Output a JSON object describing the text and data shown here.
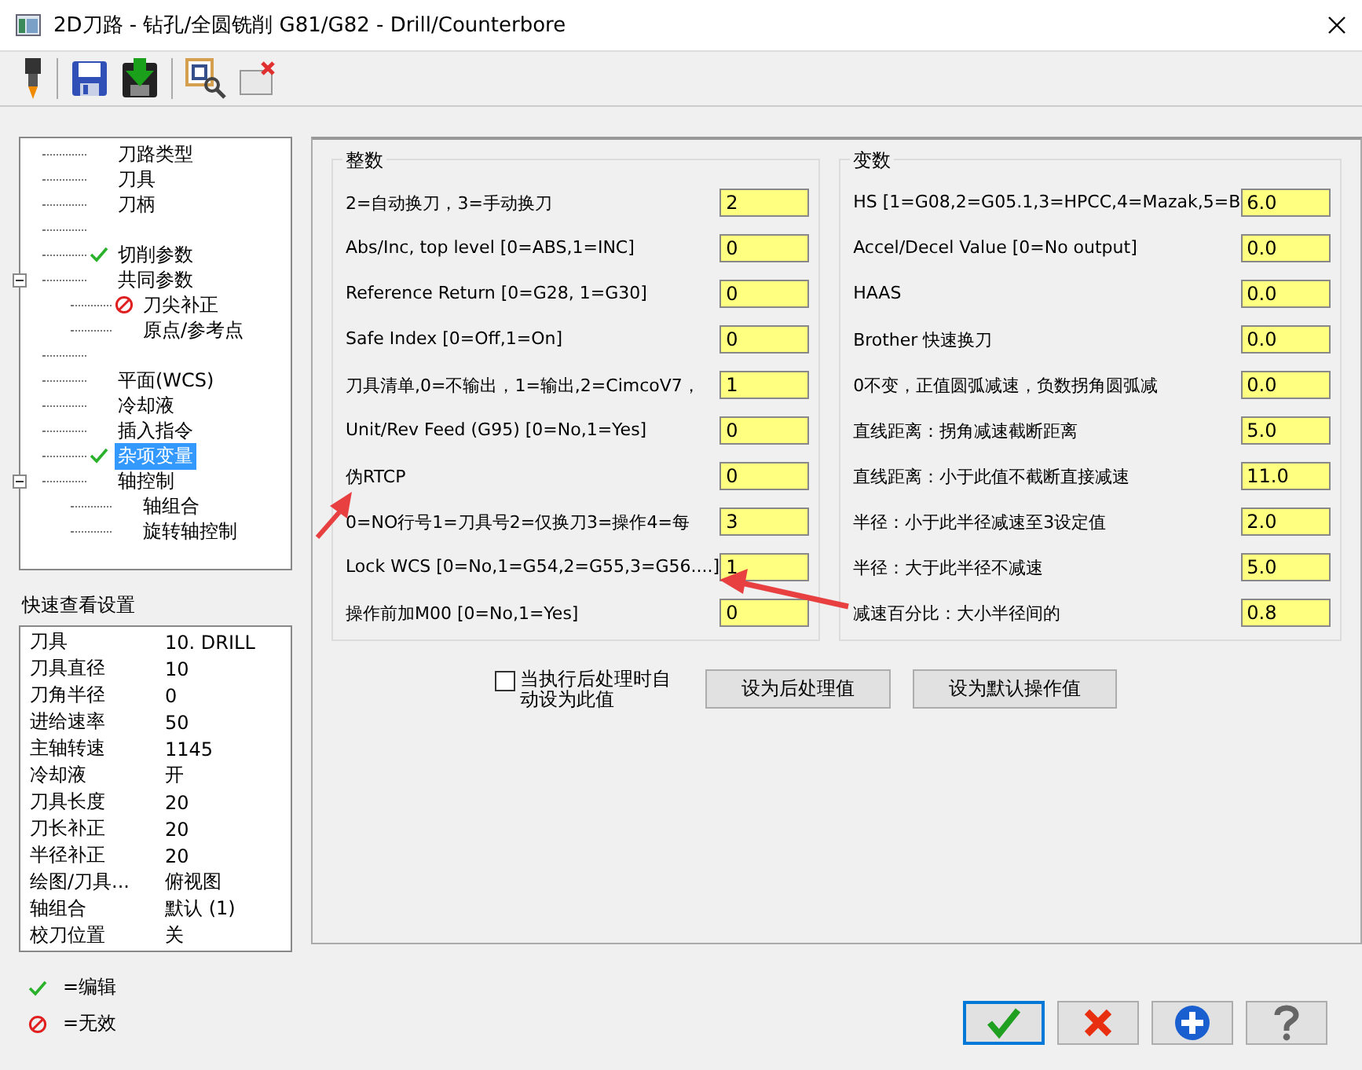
{
  "window": {
    "title": "2D刀路 - 钻孔/全圆铣削 G81/G82 - Drill/Counterbore"
  },
  "toolbar": [
    {
      "kind": "drill"
    },
    {
      "kind": "save"
    },
    {
      "kind": "save-arrow"
    },
    {
      "kind": "preview"
    },
    {
      "kind": "close-window"
    }
  ],
  "tree": [
    {
      "kind": "item",
      "label": "刀路类型",
      "selected": false
    },
    {
      "kind": "item",
      "label": "刀具",
      "selected": false
    },
    {
      "kind": "item",
      "label": "刀柄",
      "selected": false
    },
    {
      "kind": "spacer"
    },
    {
      "kind": "item",
      "label": "切削参数",
      "edited": true,
      "selected": false
    },
    {
      "kind": "item",
      "label": "共同参数",
      "selected": false,
      "expanded": true,
      "children": [
        {
          "kind": "item",
          "label": "刀尖补正",
          "disabled": true,
          "selected": false
        },
        {
          "kind": "item",
          "label": "原点/参考点",
          "selected": false
        }
      ]
    },
    {
      "kind": "spacer"
    },
    {
      "kind": "item",
      "label": "平面(WCS)",
      "selected": false
    },
    {
      "kind": "item",
      "label": "冷却液",
      "selected": false
    },
    {
      "kind": "item",
      "label": "插入指令",
      "selected": false
    },
    {
      "kind": "item",
      "label": "杂项变量",
      "edited": true,
      "selected": true
    },
    {
      "kind": "item",
      "label": "轴控制",
      "selected": false,
      "expanded": true,
      "children": [
        {
          "kind": "item",
          "label": "轴组合",
          "selected": false
        },
        {
          "kind": "item",
          "label": "旋转轴控制",
          "selected": false
        }
      ]
    }
  ],
  "quick_view": {
    "title": "快速查看设置",
    "rows": [
      {
        "name": "刀具",
        "value": "10. DRILL"
      },
      {
        "name": "刀具直径",
        "value": "10"
      },
      {
        "name": "刀角半径",
        "value": "0"
      },
      {
        "name": "进给速率",
        "value": "50"
      },
      {
        "name": "主轴转速",
        "value": "1145"
      },
      {
        "name": "冷却液",
        "value": "开"
      },
      {
        "name": "刀具长度",
        "value": "20"
      },
      {
        "name": "刀长补正",
        "value": "20"
      },
      {
        "name": "半径补正",
        "value": "20"
      },
      {
        "name": "绘图/刀具...",
        "value": "俯视图"
      },
      {
        "name": "轴组合",
        "value": "默认 (1)"
      },
      {
        "name": "校刀位置",
        "value": "关"
      }
    ]
  },
  "legend": [
    {
      "kind": "edited",
      "label": "=编辑"
    },
    {
      "kind": "disabled",
      "label": "=无效"
    }
  ],
  "groups": [
    {
      "title": "整数",
      "rows": [
        {
          "label": "2=自动换刀，3=手动换刀",
          "value": "2"
        },
        {
          "label": "Abs/Inc, top level [0=ABS,1=INC]",
          "value": "0"
        },
        {
          "label": "Reference Return [0=G28, 1=G30]",
          "value": "0"
        },
        {
          "label": "Safe Index [0=Off,1=On]",
          "value": "0"
        },
        {
          "label": "刀具清单,0=不输出，1=输出,2=CimcoV7，",
          "value": "1"
        },
        {
          "label": "Unit/Rev Feed (G95) [0=No,1=Yes]",
          "value": "0"
        },
        {
          "label": "伪RTCP",
          "value": "0"
        },
        {
          "label": "0=NO行号1=刀具号2=仅换刀3=操作4=每",
          "value": "3"
        },
        {
          "label": "Lock  WCS [0=No,1=G54,2=G55,3=G56....]",
          "value": "1"
        },
        {
          "label": "操作前加M00 [0=No,1=Yes]",
          "value": "0"
        }
      ]
    },
    {
      "title": "变数",
      "rows": [
        {
          "label": "HS [1=G08,2=G05.1,3=HPCC,4=Mazak,5=B",
          "value": "6.0"
        },
        {
          "label": "Accel/Decel Value [0=No output]",
          "value": "0.0"
        },
        {
          "label": "HAAS",
          "value": "0.0"
        },
        {
          "label": "Brother 快速换刀",
          "value": "0.0"
        },
        {
          "label": "0不变，正值圆弧减速，负数拐角圆弧减",
          "value": "0.0"
        },
        {
          "label": "直线距离：拐角减速截断距离",
          "value": "5.0"
        },
        {
          "label": "直线距离：小于此值不截断直接减速",
          "value": "11.0"
        },
        {
          "label": "半径：小于此半径减速至3设定值",
          "value": "2.0"
        },
        {
          "label": "半径：大于此半径不减速",
          "value": "5.0"
        },
        {
          "label": "减速百分比：大小半径间的",
          "value": "0.8"
        }
      ]
    }
  ],
  "auto_set": {
    "label": "当执行后处理时自动设为此值",
    "checked": false
  },
  "buttons": [
    "设为后处理值",
    "设为默认操作值"
  ],
  "dialog_buttons": [
    {
      "kind": "ok",
      "selected": true
    },
    {
      "kind": "cancel",
      "selected": false
    },
    {
      "kind": "add",
      "selected": false
    },
    {
      "kind": "help",
      "selected": false
    }
  ]
}
